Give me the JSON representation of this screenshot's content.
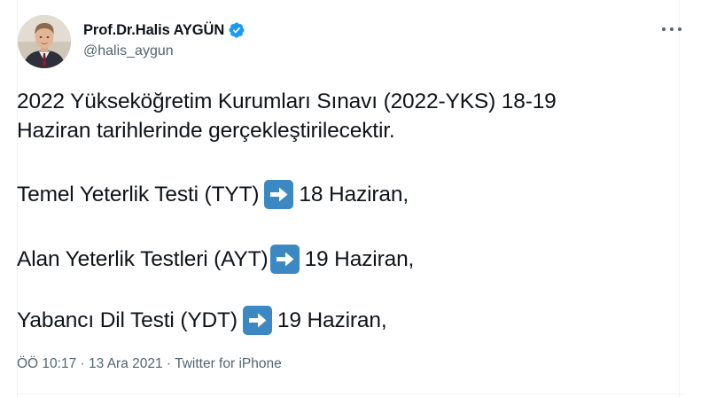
{
  "author": {
    "display_name": "Prof.Dr.Halis AYGÜN",
    "handle": "@halis_aygun",
    "verified": true
  },
  "tweet": {
    "paragraph_line1": "2022 Yükseköğretim Kurumları Sınavı (2022-YKS) 18-19",
    "paragraph_line2": "Haziran tarihlerinde gerçekleştirilecektir.",
    "items": [
      {
        "before": "Temel Yeterlik Testi (TYT)",
        "after": "18 Haziran,"
      },
      {
        "before": "Alan Yeterlik Testleri (AYT)",
        "after": "19 Haziran,"
      },
      {
        "before": "Yabancı Dil Testi (YDT)",
        "after": "19 Haziran,"
      }
    ]
  },
  "meta": {
    "time": "ÖÖ 10:17",
    "separator1": " · ",
    "date": "13 Ara 2021",
    "separator2": " · ",
    "source": "Twitter for iPhone"
  },
  "colors": {
    "text": "#0f1419",
    "secondary": "#536471",
    "verified_blue": "#1d9bf0",
    "arrow_emoji_bg": "#3b88c3"
  },
  "icons": {
    "verified": "verified-badge-icon",
    "more": "more-options-icon",
    "arrow": "right-arrow-emoji-icon"
  }
}
